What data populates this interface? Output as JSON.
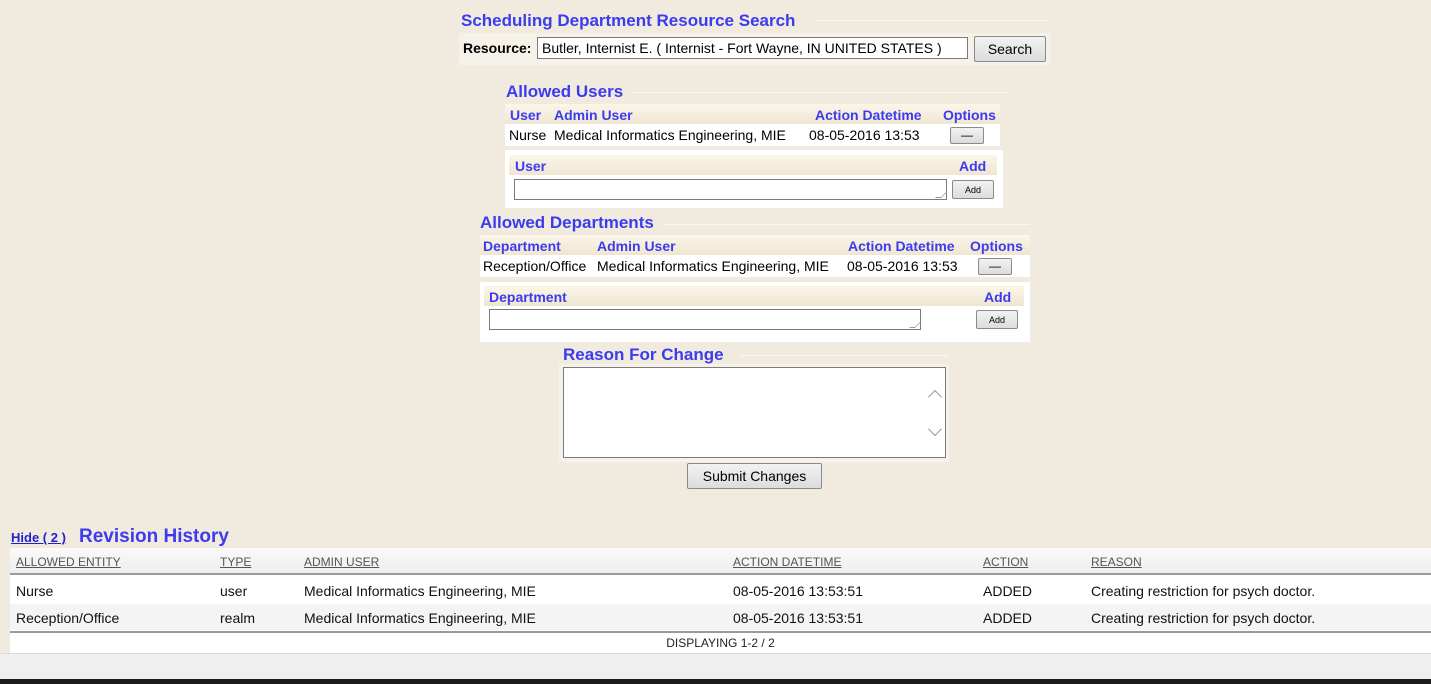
{
  "scheduling": {
    "title": "Scheduling Department Resource Search",
    "resource_label": "Resource:",
    "resource_value": "Butler, Internist E. ( Internist - Fort Wayne, IN UNITED STATES ) ",
    "search_label": "Search"
  },
  "allowed_users": {
    "title": "Allowed Users",
    "columns": [
      "User",
      "Admin User",
      "Action Datetime",
      "Options"
    ],
    "rows": [
      {
        "user": "Nurse",
        "admin_user": "Medical Informatics Engineering, MIE",
        "action_datetime": "08-05-2016 13:53",
        "remove_label": "—"
      }
    ],
    "add_section": {
      "user_label": "User",
      "add_header": "Add",
      "add_button": "Add",
      "user_value": ""
    }
  },
  "allowed_departments": {
    "title": "Allowed Departments",
    "columns": [
      "Department",
      "Admin User",
      "Action Datetime",
      "Options"
    ],
    "rows": [
      {
        "department": "Reception/Office",
        "admin_user": "Medical Informatics Engineering, MIE",
        "action_datetime": "08-05-2016 13:53",
        "remove_label": "—"
      }
    ],
    "add_section": {
      "department_label": "Department",
      "add_header": "Add",
      "add_button": "Add",
      "department_value": ""
    }
  },
  "reason": {
    "title": "Reason For Change",
    "value": ""
  },
  "submit_label": "Submit Changes",
  "revision_history": {
    "hide_link": "Hide ( 2 )",
    "title": "Revision History",
    "columns": [
      "ALLOWED ENTITY",
      "TYPE",
      "ADMIN USER",
      "ACTION DATETIME",
      "ACTION",
      "REASON"
    ],
    "rows": [
      {
        "entity": "Nurse",
        "type": "user",
        "admin_user": "Medical Informatics Engineering, MIE",
        "datetime": "08-05-2016 13:53:51",
        "action": "ADDED",
        "reason": "Creating restriction for psych doctor."
      },
      {
        "entity": "Reception/Office",
        "type": "realm",
        "admin_user": "Medical Informatics Engineering, MIE",
        "datetime": "08-05-2016 13:53:51",
        "action": "ADDED",
        "reason": "Creating restriction for psych doctor."
      }
    ],
    "displaying": "DISPLAYING 1-2 / 2"
  }
}
